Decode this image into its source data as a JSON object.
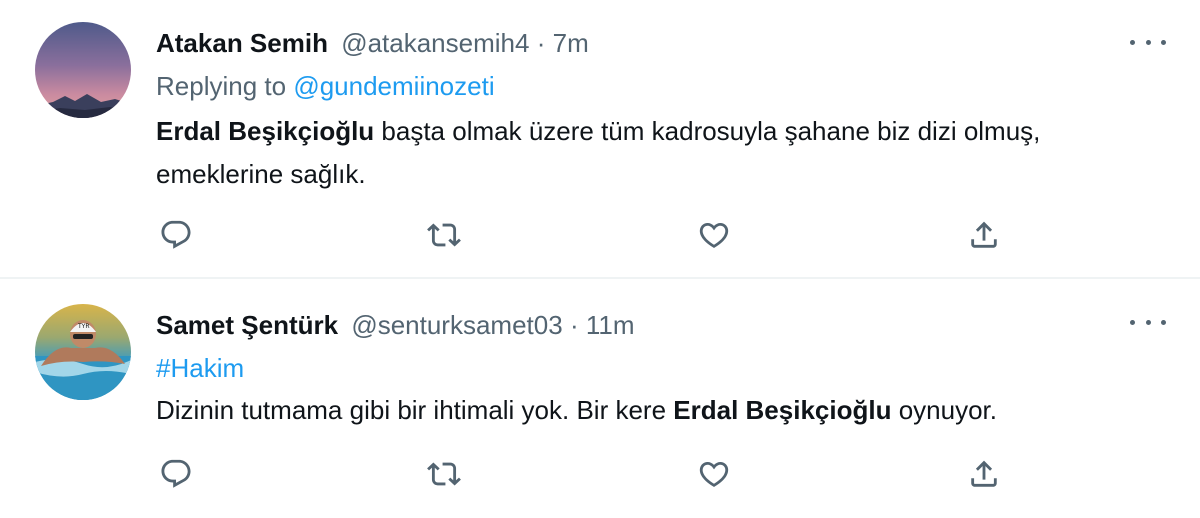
{
  "tweets": [
    {
      "author_name": "Atakan Semih",
      "handle": "@atakansemih4",
      "separator": "·",
      "time": "7m",
      "replying_prefix": "Replying to",
      "replying_handle": "@gundemiinozeti",
      "body_bold": "Erdal Beşikçioğlu",
      "body_rest": " başta olmak üzere tüm kadrosuyla şahane biz dizi olmuş, emeklerine sağlık."
    },
    {
      "author_name": "Samet Şentürk",
      "handle": "@senturksamet03",
      "separator": "·",
      "time": "11m",
      "hashtag": "#Hakim",
      "body_pre": "Dizinin tutmama gibi bir ihtimali yok. Bir kere ",
      "body_bold": "Erdal Beşikçioğlu",
      "body_post": " oynuyor."
    }
  ],
  "icons": {
    "reply": "reply-icon",
    "retweet": "retweet-icon",
    "like": "like-icon",
    "share": "share-icon",
    "more": "more-icon"
  },
  "colors": {
    "text": "#0f1419",
    "secondary": "#536471",
    "link": "#1d9bf0",
    "divider": "#eff3f4"
  }
}
